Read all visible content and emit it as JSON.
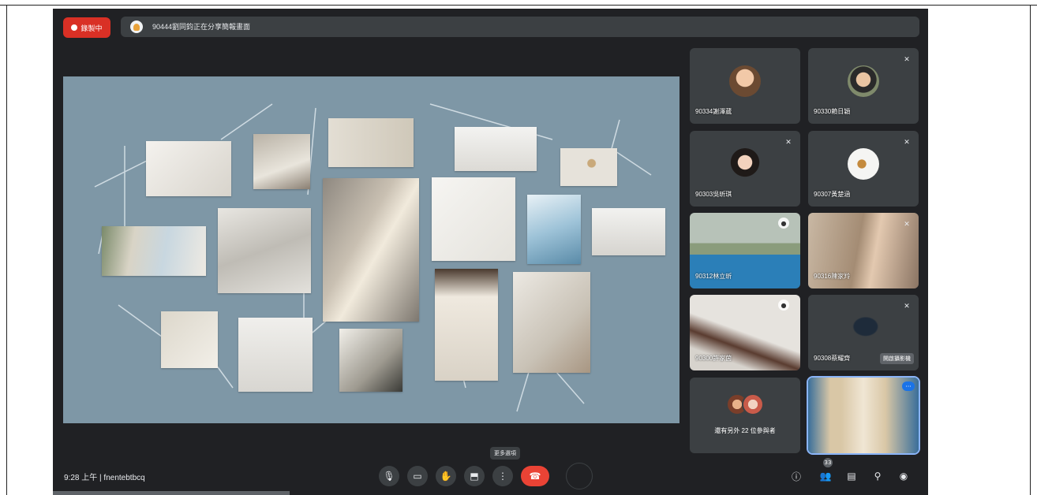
{
  "recording": {
    "label": "錄製中"
  },
  "banner": {
    "text": "90444劉同鈞正在分享簡報畫面"
  },
  "participants": [
    {
      "name": "90334謝澤葳",
      "muted": false
    },
    {
      "name": "90330賴日穎",
      "muted": true
    },
    {
      "name": "90303吳昕琪",
      "muted": true
    },
    {
      "name": "90307黃楚涵",
      "muted": true
    },
    {
      "name": "90312林立昕",
      "muted": false
    },
    {
      "name": "90316陳家羚",
      "muted": true
    },
    {
      "name": "90300許家茵",
      "muted": false
    },
    {
      "name": "90308蔡耀齊",
      "muted": true,
      "tooltip": "開啟攝影機"
    },
    {
      "name": "還有另外 22 位參與者",
      "muted": false
    },
    {
      "name": "",
      "self": true,
      "more": "···"
    }
  ],
  "bottom_bar": {
    "time": "9:28 上午",
    "meeting_code": "fnentebtbcq",
    "hint": "更多選項",
    "people_count": "33"
  },
  "icons": {
    "mic": "mic-icon",
    "camera": "camera-icon",
    "raise_hand": "raise-hand-icon",
    "present": "present-icon",
    "more": "more-vert-icon",
    "hangup": "phone-hangup-icon",
    "info": "info-icon",
    "people": "people-icon",
    "chat": "chat-icon",
    "activities": "activities-icon",
    "host": "host-controls-icon"
  },
  "colors": {
    "record_red": "#d93025",
    "hangup_red": "#ea4335",
    "slide_bg": "#7e97a6",
    "self_outline": "#8ab4f8"
  }
}
